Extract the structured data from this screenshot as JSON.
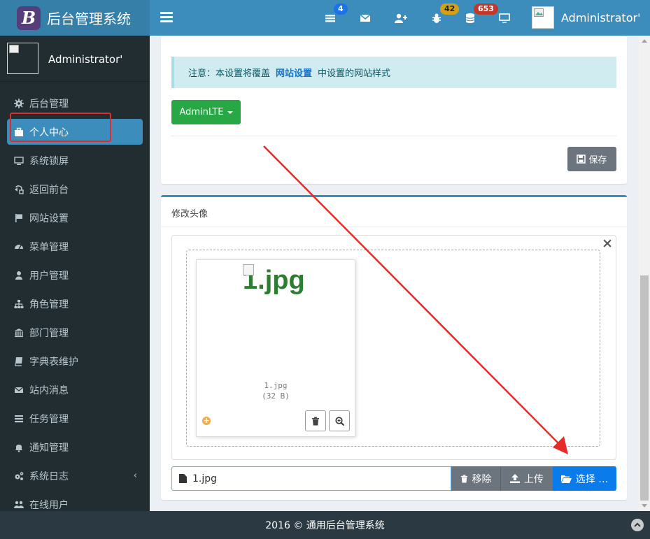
{
  "header": {
    "logo_letter": "B",
    "app_title": "后台管理系统",
    "badge_tasks": "4",
    "badge_bugs": "42",
    "badge_db": "653",
    "user_name": "Administrator'",
    "colors": {
      "navbar": "#3c8dbc",
      "logo_bg": "#367fa9",
      "badge_blue": "#1a73e8",
      "badge_yellow": "#d4a017",
      "badge_red": "#c0392b"
    }
  },
  "sidebar": {
    "user_name": "Administrator'",
    "items": [
      {
        "label": "后台管理",
        "icon": "gear-icon"
      },
      {
        "label": "个人中心",
        "icon": "briefcase-icon"
      },
      {
        "label": "系统锁屏",
        "icon": "monitor-icon"
      },
      {
        "label": "返回前台",
        "icon": "external-icon"
      },
      {
        "label": "网站设置",
        "icon": "flag-icon"
      },
      {
        "label": "菜单管理",
        "icon": "dashboard-icon"
      },
      {
        "label": "用户管理",
        "icon": "user-icon"
      },
      {
        "label": "角色管理",
        "icon": "sitemap-icon"
      },
      {
        "label": "部门管理",
        "icon": "bank-icon"
      },
      {
        "label": "字典表维护",
        "icon": "book-icon"
      },
      {
        "label": "站内消息",
        "icon": "envelope-icon"
      },
      {
        "label": "任务管理",
        "icon": "tasks-icon"
      },
      {
        "label": "通知管理",
        "icon": "bell-icon"
      },
      {
        "label": "系统日志",
        "icon": "cogs-icon"
      },
      {
        "label": "在线用户",
        "icon": "users-icon"
      }
    ]
  },
  "theme_box": {
    "notice_prefix": "注意：本设置将覆盖",
    "notice_link": "网站设置",
    "notice_suffix": "中设置的网站样式",
    "theme_dropdown": "AdminLTE",
    "save_label": "保存"
  },
  "avatar_box": {
    "title": "修改头像",
    "preview_image_text": "1.jpg",
    "file_name": "1.jpg",
    "file_size": "(32 B)",
    "input_value": "1.jpg",
    "remove_label": "移除",
    "upload_label": "上传",
    "browse_label": "选择 …"
  },
  "footer": {
    "text": "2016 © 通用后台管理系统"
  }
}
